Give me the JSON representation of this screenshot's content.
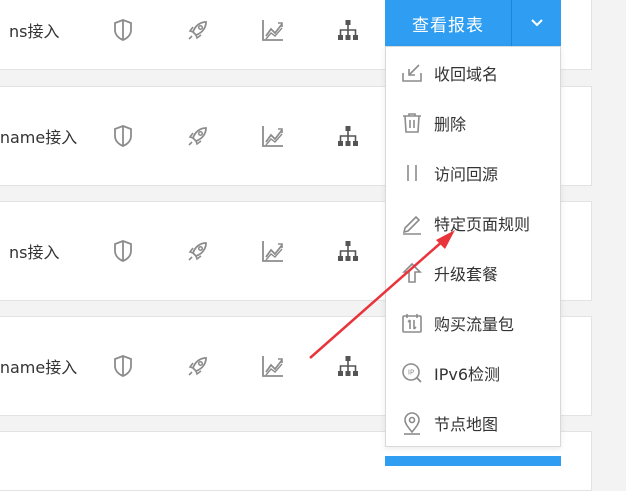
{
  "rows": [
    {
      "label": "ns接入"
    },
    {
      "label": "ename接入"
    },
    {
      "label": "ns接入"
    },
    {
      "label": "ename接入"
    },
    {
      "label": ""
    }
  ],
  "row_icons": [
    "shield-icon",
    "rocket-icon",
    "chart-trend-icon",
    "sitemap-icon"
  ],
  "report_button": {
    "label": "查看报表",
    "caret": "chevron-down-icon"
  },
  "menu": {
    "items": [
      {
        "label": "收回域名",
        "icon": "reclaim-domain-icon"
      },
      {
        "label": "删除",
        "icon": "trash-icon"
      },
      {
        "label": "访问回源",
        "icon": "pause-bars-icon"
      },
      {
        "label": "特定页面规则",
        "icon": "pencil-icon"
      },
      {
        "label": "升级套餐",
        "icon": "upgrade-arrow-icon"
      },
      {
        "label": "购买流量包",
        "icon": "traffic-package-icon"
      },
      {
        "label": "IPv6检测",
        "icon": "ipv6-check-icon"
      },
      {
        "label": "节点地图",
        "icon": "location-pin-icon"
      }
    ]
  },
  "colors": {
    "primary": "#2f9ef2",
    "annotation_arrow": "#e8343a",
    "icon_gray": "#8c8c8c"
  }
}
